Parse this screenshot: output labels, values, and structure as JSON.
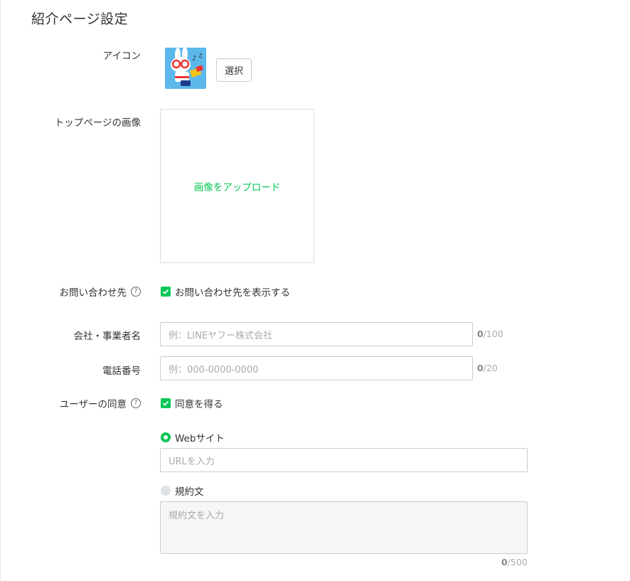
{
  "page": {
    "title": "紹介ページ設定"
  },
  "icon_section": {
    "label": "アイコン",
    "select_button": "選択"
  },
  "top_image": {
    "label": "トップページの画像",
    "upload_link": "画像をアップロード"
  },
  "contact": {
    "label": "お問い合わせ先",
    "help": "?",
    "checkbox_label": "お問い合わせ先を表示する",
    "checked": true
  },
  "company": {
    "label": "会社・事業者名",
    "placeholder": "例：LINEヤフー株式会社",
    "count": "0",
    "max": "/100"
  },
  "phone": {
    "label": "電話番号",
    "placeholder": "例：000-0000-0000",
    "count": "0",
    "max": "/20"
  },
  "consent": {
    "label": "ユーザーの同意",
    "help": "?",
    "checkbox_label": "同意を得る",
    "checked": true,
    "option_website": {
      "label": "Webサイト",
      "selected": true,
      "placeholder": "URLを入力"
    },
    "option_terms": {
      "label": "規約文",
      "selected": false,
      "placeholder": "規約文を入力",
      "count": "0",
      "max": "/500"
    }
  },
  "colors": {
    "accent": "#06c755",
    "border": "#cccccc",
    "text": "#333333",
    "placeholder": "#aaaaaa"
  }
}
